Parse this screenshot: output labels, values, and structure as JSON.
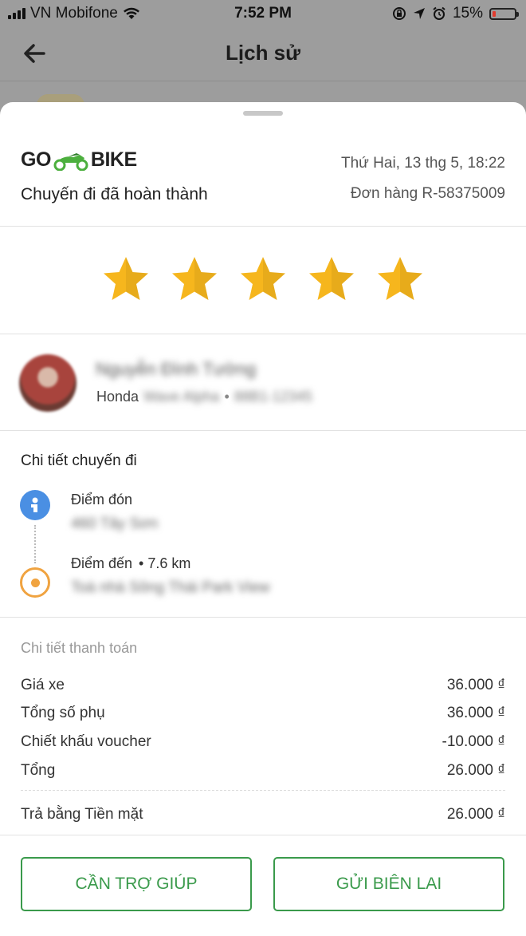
{
  "status_bar": {
    "carrier": "VN Mobifone",
    "time": "7:52 PM",
    "battery": "15%",
    "battery_level": 0.15,
    "icons": [
      "signal-icon",
      "wifi-icon",
      "rotation-lock-icon",
      "location-arrow-icon",
      "alarm-icon",
      "battery-icon"
    ]
  },
  "nav": {
    "title": "Lịch sử",
    "back_icon": "back-arrow-icon"
  },
  "order": {
    "logo_left": "GO",
    "logo_right": "BIKE",
    "date": "Thứ Hai, 13 thg 5, 18:22",
    "status": "Chuyến đi đã hoàn thành",
    "order_id": "Đơn hàng R-58375009"
  },
  "rating": {
    "stars": 5,
    "max": 5,
    "color": "#f6b61d"
  },
  "driver": {
    "name": "Nguyễn Đình Tường",
    "vehicle_make": "Honda",
    "vehicle_model": "Wave Alpha",
    "separator": "•",
    "plate": "88B1-12345"
  },
  "trip_details": {
    "title": "Chi tiết chuyến đi",
    "pickup_label": "Điểm đón",
    "pickup_address": "460 Tây Sơn",
    "dropoff_label": "Điểm đến",
    "distance": "7.6 km",
    "dropoff_address": "Toà nhà Sông Thái Park View"
  },
  "payment": {
    "title": "Chi tiết thanh toán",
    "rows": [
      {
        "label": "Giá xe",
        "amount": "36.000 ₫"
      },
      {
        "label": "Tổng số phụ",
        "amount": "36.000 ₫"
      },
      {
        "label": "Chiết khấu voucher",
        "amount": "-10.000 ₫"
      },
      {
        "label": "Tổng",
        "amount": "26.000 ₫"
      }
    ],
    "paid_with": {
      "label": "Trả bằng Tiền mặt",
      "amount": "26.000 ₫"
    }
  },
  "actions": {
    "help_label": "CẦN TRỢ GIÚP",
    "receipt_label": "GỬI BIÊN LAI"
  },
  "colors": {
    "accent_green": "#3a9a4b",
    "star": "#f6b61d",
    "pickup_pin": "#4a8fe3",
    "dropoff_pin": "#f0a340"
  }
}
